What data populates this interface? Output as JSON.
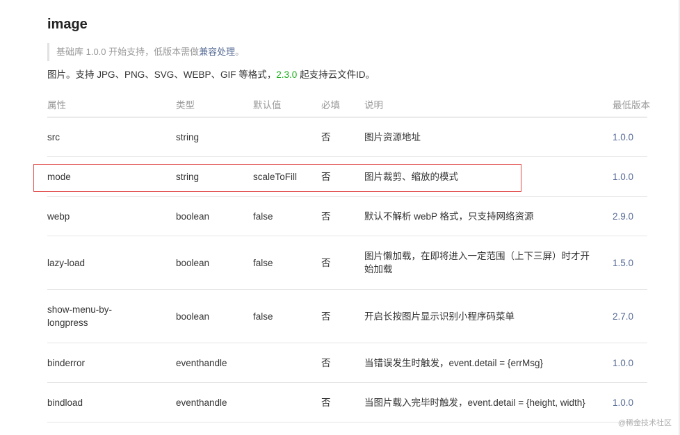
{
  "doc": {
    "title": "image",
    "note_prefix": "基础库 1.0.0 开始支持，低版本需做",
    "note_link": "兼容处理",
    "note_suffix": "。",
    "desc_prefix": "图片。支持 JPG、PNG、SVG、WEBP、GIF 等格式，",
    "desc_version": "2.3.0",
    "desc_suffix": " 起支持云文件ID。"
  },
  "table": {
    "headers": [
      "属性",
      "类型",
      "默认值",
      "必填",
      "说明",
      "最低版本"
    ],
    "rows": [
      {
        "attr": "src",
        "type": "string",
        "default": "",
        "required": "否",
        "desc": "图片资源地址",
        "version": "1.0.0"
      },
      {
        "attr": "mode",
        "type": "string",
        "default": "scaleToFill",
        "required": "否",
        "desc": "图片裁剪、缩放的模式",
        "version": "1.0.0"
      },
      {
        "attr": "webp",
        "type": "boolean",
        "default": "false",
        "required": "否",
        "desc": "默认不解析 webP 格式，只支持网络资源",
        "version": "2.9.0"
      },
      {
        "attr": "lazy-load",
        "type": "boolean",
        "default": "false",
        "required": "否",
        "desc": "图片懒加载，在即将进入一定范围（上下三屏）时才开始加载",
        "version": "1.5.0"
      },
      {
        "attr": "show-menu-by-longpress",
        "type": "boolean",
        "default": "false",
        "required": "否",
        "desc": "开启长按图片显示识别小程序码菜单",
        "version": "2.7.0"
      },
      {
        "attr": "binderror",
        "type": "eventhandle",
        "default": "",
        "required": "否",
        "desc": "当错误发生时触发，event.detail = {errMsg}",
        "version": "1.0.0"
      },
      {
        "attr": "bindload",
        "type": "eventhandle",
        "default": "",
        "required": "否",
        "desc": "当图片载入完毕时触发，event.detail = {height, width}",
        "version": "1.0.0"
      }
    ]
  },
  "watermark": "@稀金技术社区",
  "colors": {
    "link": "#576b95",
    "version_green": "#1aad19",
    "highlight_border": "#e24b4b"
  }
}
